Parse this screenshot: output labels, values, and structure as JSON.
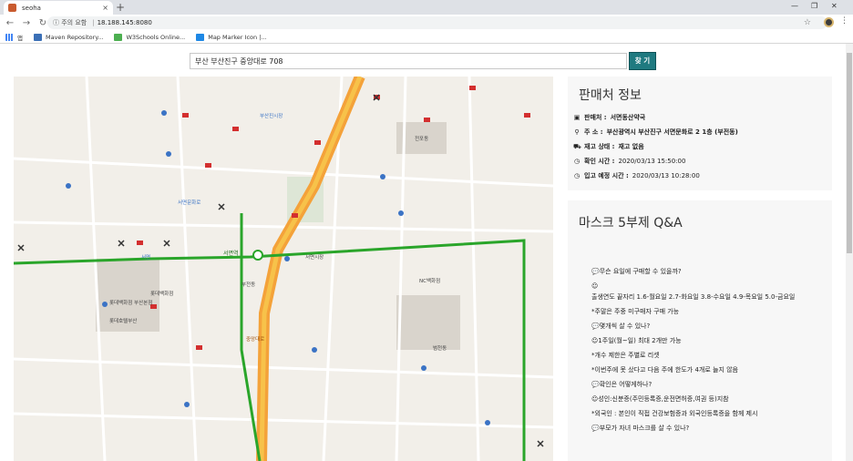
{
  "browser": {
    "tab_title": "seoha",
    "tab_close": "×",
    "new_tab": "+",
    "url_info": "ⓘ 주의 요함",
    "url_host": "18.188.145:8080",
    "bookmarks": [
      {
        "label": "앱",
        "icon": "apps-grid-icon"
      },
      {
        "label": "Maven Repository...",
        "icon": "maven-icon"
      },
      {
        "label": "W3Schools Online...",
        "icon": "w3schools-icon"
      },
      {
        "label": "Map Marker Icon |...",
        "icon": "bookmark-page-icon"
      }
    ]
  },
  "search": {
    "value": "부산 부산진구 중앙대로 708",
    "button_label": "찾 기"
  },
  "map": {
    "labels": [
      "서면역",
      "롯데백화점 부산본점",
      "서면문화로",
      "롯데호텔부산",
      "부산진시장",
      "전포동",
      "부전동",
      "범천동",
      "NC백화점",
      "서면시장",
      "중앙대로",
      "서면",
      "롯데백화점"
    ]
  },
  "seller": {
    "title": "판매처 정보",
    "rows": [
      {
        "icon": "id-card-icon",
        "label": "판매처 :",
        "value": "서면동산약국"
      },
      {
        "icon": "map-pin-icon",
        "label": "주 소 :",
        "value": "부산광역시 부산진구 서면문화로 2 1층 (부전동)"
      },
      {
        "icon": "truck-icon",
        "label": "재고 상태 :",
        "value": "재고 없음"
      },
      {
        "icon": "clock-icon",
        "label": "확인 시간 :",
        "value": "2020/03/13 15:50:00"
      },
      {
        "icon": "clock-icon",
        "label": "입고 예정 시간 :",
        "value": "2020/03/13 10:28:00"
      }
    ]
  },
  "qa": {
    "title": "마스크 5부제 Q&A",
    "lines": [
      "💬무슨 요일에 구매할 수 있을까?",
      "☺",
      "출생연도 끝자리 1.6-월요일 2.7-화요일 3.8-수요일 4.9-목요일 5.0-금요일",
      "*주말은 주중 미구매자 구매 가능",
      "💬몇개씩 살 수 있나?",
      "☺1주일(월~일) 최대 2개만 가능",
      "*개수 제한은 주별로 리셋",
      "*이번주에 못 샀다고 다음 주에 한도가 4개로 늘지 않음",
      "💬확인은 어떻게하나?",
      "☺성인:신분증(주민등록증,운전면허증,여권 등)지참",
      "*외국인 : 본인이 직접 건강보험증과 외국인등록증을 함께 제시",
      "💬부모가 자녀 마스크를 살 수 있나?"
    ]
  },
  "colors": {
    "accent": "#1f7a80",
    "subway_green": "#2aa52a",
    "main_road": "#f4a23a",
    "map_bg": "#f2efe9"
  }
}
